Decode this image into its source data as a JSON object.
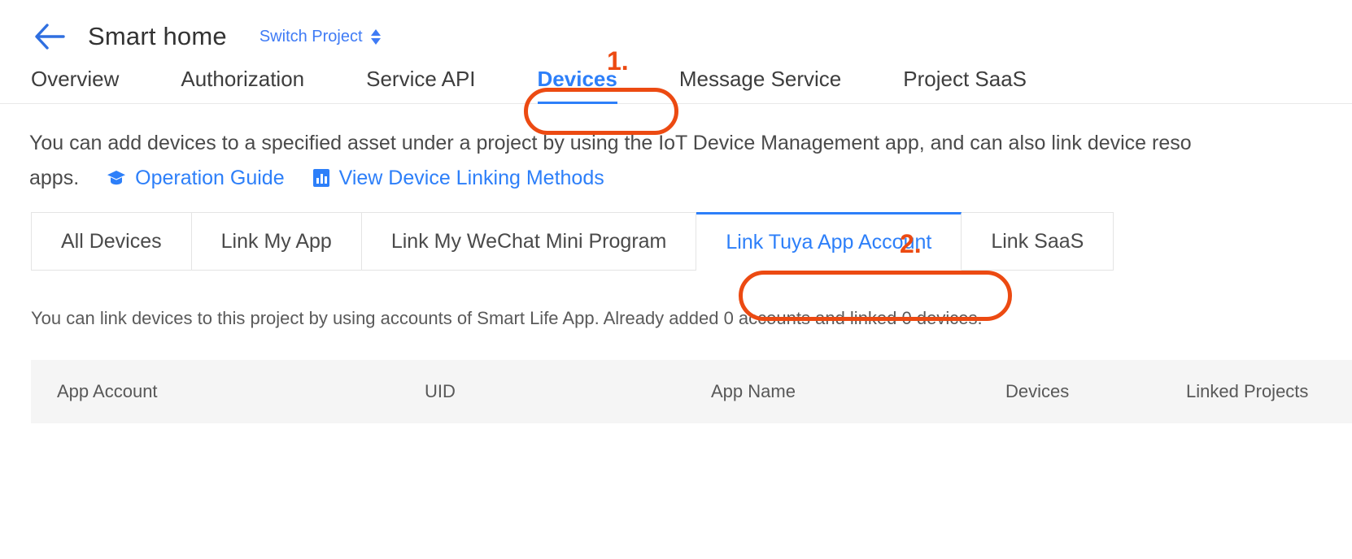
{
  "header": {
    "back_icon": "back-arrow-icon",
    "project_title": "Smart home",
    "switch_project_label": "Switch Project",
    "switch_project_icon": "up-down-caret-icon"
  },
  "main_tabs": [
    {
      "label": "Overview",
      "active": false
    },
    {
      "label": "Authorization",
      "active": false
    },
    {
      "label": "Service API",
      "active": false
    },
    {
      "label": "Devices",
      "active": true
    },
    {
      "label": "Message Service",
      "active": false
    },
    {
      "label": "Project SaaS",
      "active": false
    }
  ],
  "description": {
    "line1": "You can add devices to a specified asset under a project by using the IoT Device Management app, and can also link device reso",
    "line2_prefix": "apps.",
    "links": [
      {
        "label": "Operation Guide",
        "icon": "graduation-cap-icon"
      },
      {
        "label": "View Device Linking Methods",
        "icon": "document-chart-icon"
      }
    ]
  },
  "sub_tabs": [
    {
      "label": "All Devices",
      "active": false
    },
    {
      "label": "Link My App",
      "active": false
    },
    {
      "label": "Link My WeChat Mini Program",
      "active": false
    },
    {
      "label": "Link Tuya App Account",
      "active": true
    },
    {
      "label": "Link SaaS",
      "active": false
    }
  ],
  "info_line": "You can link devices to this project by using accounts of Smart Life App. Already added 0 accounts and linked 0 devices.",
  "table": {
    "columns": [
      "App Account",
      "UID",
      "App Name",
      "Devices",
      "Linked Projects"
    ],
    "rows": []
  },
  "annotations": [
    {
      "number": "1.",
      "target": "main-tab-devices"
    },
    {
      "number": "2.",
      "target": "sub-tab-link-tuya-app-account"
    }
  ],
  "colors": {
    "accent_blue": "#2d7ff9",
    "link_blue": "#3f7bf5",
    "annotation_orange": "#ec4a12",
    "table_header_bg": "#f5f5f5"
  }
}
